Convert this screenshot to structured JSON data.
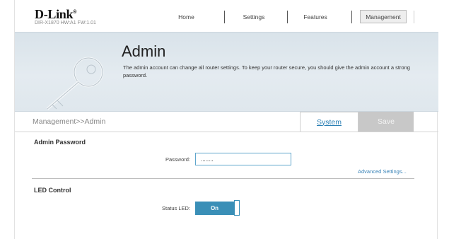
{
  "header": {
    "logo": "D-Link",
    "model": "DIR-X1870 HW:A1 FW:1.01",
    "nav": [
      "Home",
      "Settings",
      "Features",
      "Management"
    ]
  },
  "hero": {
    "title": "Admin",
    "description": "The admin account can change all router settings. To keep your router secure, you should give the admin account a strong password."
  },
  "breadcrumb": "Management>>Admin",
  "actions": {
    "system": "System",
    "save": "Save"
  },
  "admin_password": {
    "title": "Admin Password",
    "password_label": "Password:",
    "password_value": "........"
  },
  "advanced_link": "Advanced Settings...",
  "led": {
    "title": "LED Control",
    "status_label": "Status LED:",
    "status_value": "On"
  }
}
